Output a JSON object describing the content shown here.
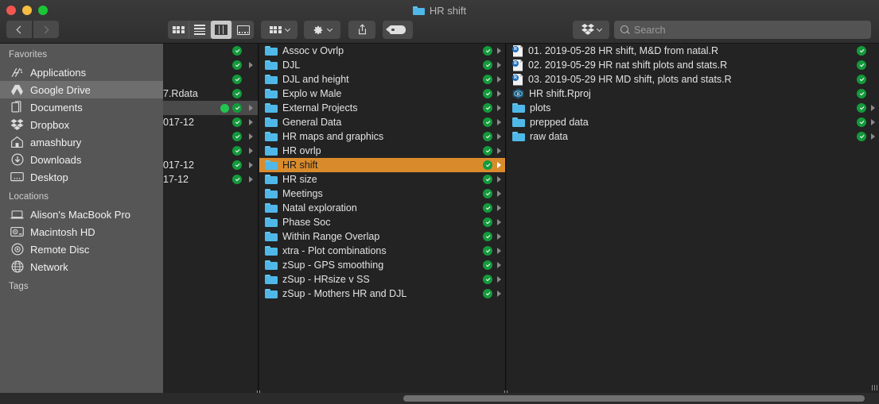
{
  "window": {
    "title": "HR shift",
    "title_icon": "folder-icon",
    "traffic_lights": [
      "close-red",
      "minimize-yellow",
      "zoom-green"
    ]
  },
  "toolbar": {
    "back_label": "Back",
    "forward_label": "Forward",
    "view_buttons": [
      {
        "name": "icon-view",
        "label": "Icon View",
        "active": false
      },
      {
        "name": "list-view",
        "label": "List View",
        "active": false
      },
      {
        "name": "column-view",
        "label": "Column View",
        "active": true
      },
      {
        "name": "gallery-view",
        "label": "Gallery View",
        "active": false
      }
    ],
    "arrange_label": "Arrange",
    "action_label": "Action",
    "share_label": "Share",
    "tags_label": "Edit Tags",
    "dropbox_label": "Dropbox"
  },
  "search": {
    "placeholder": "Search",
    "value": ""
  },
  "sidebar": {
    "sections": [
      {
        "header": "Favorites",
        "items": [
          {
            "label": "Applications",
            "icon": "applications-icon",
            "selected": false
          },
          {
            "label": "Google Drive",
            "icon": "google-drive-icon",
            "selected": true
          },
          {
            "label": "Documents",
            "icon": "documents-icon",
            "selected": false
          },
          {
            "label": "Dropbox",
            "icon": "dropbox-icon",
            "selected": false
          },
          {
            "label": "amashbury",
            "icon": "home-icon",
            "selected": false
          },
          {
            "label": "Downloads",
            "icon": "downloads-icon",
            "selected": false
          },
          {
            "label": "Desktop",
            "icon": "desktop-icon",
            "selected": false
          }
        ]
      },
      {
        "header": "Locations",
        "items": [
          {
            "label": "Alison's MacBook Pro",
            "icon": "laptop-icon",
            "selected": false
          },
          {
            "label": "Macintosh HD",
            "icon": "harddisk-icon",
            "selected": false
          },
          {
            "label": "Remote Disc",
            "icon": "disc-icon",
            "selected": false
          },
          {
            "label": "Network",
            "icon": "network-globe-icon",
            "selected": false
          }
        ]
      },
      {
        "header": "Tags",
        "items": []
      }
    ]
  },
  "columns": [
    {
      "name": "column-1",
      "clipped": true,
      "rows": [
        {
          "label": "",
          "kind": "file",
          "sync": true,
          "disclosure": false,
          "selected": false,
          "dot": false
        },
        {
          "label": "",
          "kind": "folder",
          "sync": true,
          "disclosure": true,
          "selected": false,
          "dot": false
        },
        {
          "label": "",
          "kind": "file",
          "sync": true,
          "disclosure": false,
          "selected": false,
          "dot": false
        },
        {
          "label": "7.Rdata",
          "kind": "file",
          "sync": true,
          "disclosure": false,
          "selected": false,
          "dot": false
        },
        {
          "label": "",
          "kind": "folder",
          "sync": true,
          "disclosure": true,
          "selected": true,
          "dot": true
        },
        {
          "label": "017-12",
          "kind": "folder",
          "sync": true,
          "disclosure": true,
          "selected": false,
          "dot": false
        },
        {
          "label": "",
          "kind": "folder",
          "sync": true,
          "disclosure": true,
          "selected": false,
          "dot": false
        },
        {
          "label": "",
          "kind": "folder",
          "sync": true,
          "disclosure": true,
          "selected": false,
          "dot": false
        },
        {
          "label": "017-12",
          "kind": "folder",
          "sync": true,
          "disclosure": true,
          "selected": false,
          "dot": false
        },
        {
          "label": "17-12",
          "kind": "folder",
          "sync": true,
          "disclosure": true,
          "selected": false,
          "dot": false
        }
      ]
    },
    {
      "name": "column-2",
      "clipped": false,
      "rows": [
        {
          "label": "Assoc v Ovrlp",
          "kind": "folder",
          "sync": true,
          "disclosure": true,
          "selected": false,
          "dot": false
        },
        {
          "label": "DJL",
          "kind": "folder",
          "sync": true,
          "disclosure": true,
          "selected": false,
          "dot": false
        },
        {
          "label": "DJL and height",
          "kind": "folder",
          "sync": true,
          "disclosure": true,
          "selected": false,
          "dot": false
        },
        {
          "label": "Explo w Male",
          "kind": "folder",
          "sync": true,
          "disclosure": true,
          "selected": false,
          "dot": false
        },
        {
          "label": "External Projects",
          "kind": "folder",
          "sync": true,
          "disclosure": true,
          "selected": false,
          "dot": false
        },
        {
          "label": "General Data",
          "kind": "folder",
          "sync": true,
          "disclosure": true,
          "selected": false,
          "dot": false
        },
        {
          "label": "HR maps and graphics",
          "kind": "folder",
          "sync": true,
          "disclosure": true,
          "selected": false,
          "dot": false
        },
        {
          "label": "HR ovrlp",
          "kind": "folder",
          "sync": true,
          "disclosure": true,
          "selected": false,
          "dot": false
        },
        {
          "label": "HR shift",
          "kind": "folder",
          "sync": true,
          "disclosure": true,
          "selected": true,
          "dot": false
        },
        {
          "label": "HR size",
          "kind": "folder",
          "sync": true,
          "disclosure": true,
          "selected": false,
          "dot": false
        },
        {
          "label": "Meetings",
          "kind": "folder",
          "sync": true,
          "disclosure": true,
          "selected": false,
          "dot": false
        },
        {
          "label": "Natal exploration",
          "kind": "folder",
          "sync": true,
          "disclosure": true,
          "selected": false,
          "dot": false
        },
        {
          "label": "Phase Soc",
          "kind": "folder",
          "sync": true,
          "disclosure": true,
          "selected": false,
          "dot": false
        },
        {
          "label": "Within Range Overlap",
          "kind": "folder",
          "sync": true,
          "disclosure": true,
          "selected": false,
          "dot": false
        },
        {
          "label": "xtra - Plot combinations",
          "kind": "folder",
          "sync": true,
          "disclosure": true,
          "selected": false,
          "dot": false
        },
        {
          "label": "zSup - GPS smoothing",
          "kind": "folder",
          "sync": true,
          "disclosure": true,
          "selected": false,
          "dot": false
        },
        {
          "label": "zSup - HRsize v SS",
          "kind": "folder",
          "sync": true,
          "disclosure": true,
          "selected": false,
          "dot": false
        },
        {
          "label": "zSup - Mothers HR and DJL",
          "kind": "folder",
          "sync": true,
          "disclosure": true,
          "selected": false,
          "dot": false
        }
      ]
    },
    {
      "name": "column-3",
      "clipped": false,
      "rows": [
        {
          "label": "01. 2019-05-28 HR shift, M&D from natal.R",
          "kind": "rdoc",
          "sync": true,
          "disclosure": false,
          "selected": false,
          "dot": false
        },
        {
          "label": "02. 2019-05-29 HR nat shift plots and stats.R",
          "kind": "rdoc",
          "sync": true,
          "disclosure": false,
          "selected": false,
          "dot": false
        },
        {
          "label": "03. 2019-05-29 HR MD shift, plots and stats.R",
          "kind": "rdoc",
          "sync": true,
          "disclosure": false,
          "selected": false,
          "dot": false
        },
        {
          "label": "HR shift.Rproj",
          "kind": "rproj",
          "sync": true,
          "disclosure": false,
          "selected": false,
          "dot": false
        },
        {
          "label": "plots",
          "kind": "folder",
          "sync": true,
          "disclosure": true,
          "selected": false,
          "dot": false
        },
        {
          "label": "prepped data",
          "kind": "folder",
          "sync": true,
          "disclosure": true,
          "selected": false,
          "dot": false
        },
        {
          "label": "raw data",
          "kind": "folder",
          "sync": true,
          "disclosure": true,
          "selected": false,
          "dot": false
        }
      ]
    }
  ],
  "colors": {
    "selection_orange": "#d98b2c",
    "folder_blue": "#4fb8e8",
    "sync_green": "#149a3c",
    "sidebar_gray": "#565656",
    "column_bg": "#232323"
  }
}
